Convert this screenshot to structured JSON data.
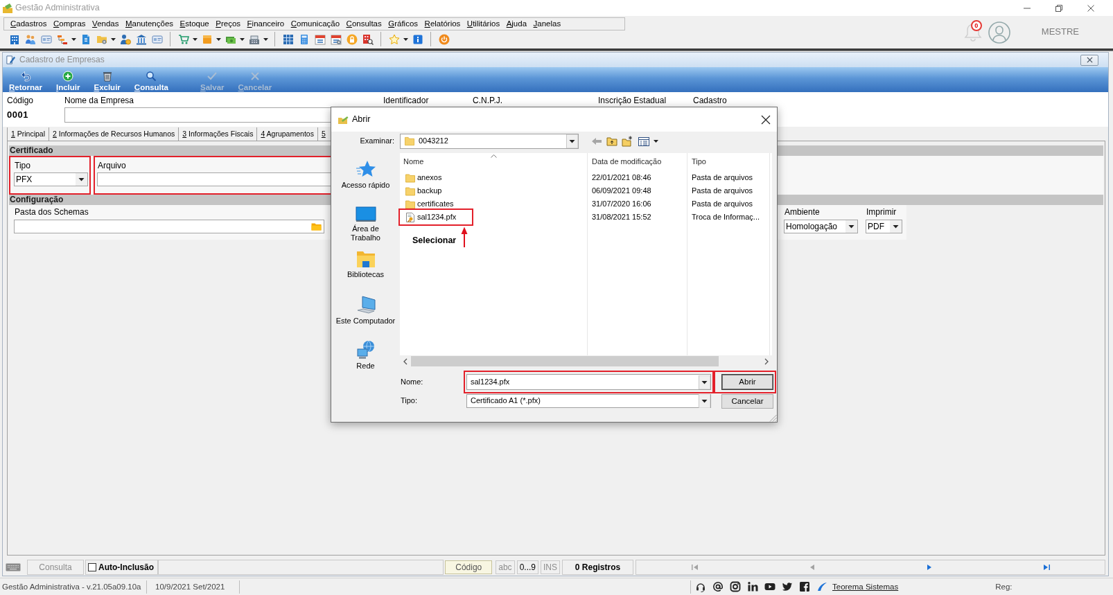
{
  "window": {
    "title": "Gestão Administrativa"
  },
  "menu": [
    "Cadastros",
    "Compras",
    "Vendas",
    "Manutenções",
    "Estoque",
    "Preços",
    "Financeiro",
    "Comunicação",
    "Consultas",
    "Gráficos",
    "Relatórios",
    "Utilitários",
    "Ajuda",
    "Janelas"
  ],
  "user": {
    "notifications": "0",
    "name": "MESTRE"
  },
  "form_window": {
    "title": "Cadastro de Empresas",
    "actions": [
      {
        "kind": "back",
        "label": "Retornar",
        "disabled": false
      },
      {
        "kind": "add",
        "label": "Incluir",
        "disabled": false
      },
      {
        "kind": "delete",
        "label": "Excluir",
        "disabled": false
      },
      {
        "kind": "search",
        "label": "Consulta",
        "disabled": false
      },
      {
        "kind": "save",
        "label": "Salvar",
        "disabled": true
      },
      {
        "kind": "cancel",
        "label": "Cancelar",
        "disabled": true
      }
    ],
    "header_fields": [
      {
        "kind": "display",
        "label": "Código",
        "value": "0001"
      },
      {
        "kind": "input",
        "label": "Nome da Empresa"
      },
      {
        "kind": "covered",
        "label": "Identificador"
      },
      {
        "kind": "covered",
        "label": "C.N.P.J."
      },
      {
        "kind": "covered",
        "label": "Inscrição Estadual"
      },
      {
        "kind": "covered",
        "label": "Cadastro"
      }
    ],
    "tabs": [
      {
        "label": "1 Principal"
      },
      {
        "label": "2 Informações de Recursos Humanos"
      },
      {
        "label": "3 Informações Fiscais"
      },
      {
        "label": "4 Agrupamentos"
      },
      {
        "label": "5"
      }
    ],
    "sections": [
      {
        "title": "Certificado",
        "fields": [
          {
            "kind": "select",
            "label": "Tipo",
            "value": "PFX",
            "highlighted": true
          },
          {
            "kind": "file",
            "label": "Arquivo",
            "highlighted": true
          }
        ]
      },
      {
        "title": "Configuração",
        "fields": [
          {
            "kind": "folder",
            "label": "Pasta dos Schemas",
            "highlighted": false
          },
          {
            "kind": "select",
            "label": "Ambiente",
            "value": "Homologação",
            "highlighted": false
          },
          {
            "kind": "select",
            "label": "Imprimir",
            "value": "PDF",
            "highlighted": false
          }
        ]
      }
    ],
    "status_bar": {
      "items": [
        {
          "kind": "label",
          "label": "Consulta",
          "disabled": true
        },
        {
          "kind": "checkbox",
          "label": "Auto-Inclusão",
          "checked": false
        },
        {
          "kind": "button",
          "label": "Código"
        },
        {
          "kind": "indicator",
          "label": "abc",
          "disabled": true
        },
        {
          "kind": "indicator",
          "label": "0...9",
          "disabled": false
        },
        {
          "kind": "indicator",
          "label": "INS",
          "disabled": true
        },
        {
          "kind": "count",
          "label": "0 Registros"
        }
      ],
      "navigation": [
        {
          "kind": "first",
          "disabled": true
        },
        {
          "kind": "previous",
          "disabled": true
        },
        {
          "kind": "next",
          "disabled": false
        },
        {
          "kind": "last",
          "disabled": false
        }
      ]
    }
  },
  "dialog": {
    "title": "Abrir",
    "look_in": {
      "label": "Examinar:",
      "value": "0043212"
    },
    "places": [
      {
        "kind": "quick_access",
        "label": "Acesso rápido"
      },
      {
        "kind": "desktop",
        "label": "Área de Trabalho"
      },
      {
        "kind": "libraries",
        "label": "Bibliotecas"
      },
      {
        "kind": "computer",
        "label": "Este Computador"
      },
      {
        "kind": "network",
        "label": "Rede"
      }
    ],
    "columns": [
      {
        "label": "Nome",
        "sorted": true
      },
      {
        "label": "Data de modificação",
        "sorted": false
      },
      {
        "label": "Tipo",
        "sorted": false
      }
    ],
    "files": [
      {
        "kind": "folder",
        "name": "anexos",
        "modified": "22/01/2021 08:46",
        "type": "Pasta de arquivos",
        "highlighted": false
      },
      {
        "kind": "folder",
        "name": "backup",
        "modified": "06/09/2021 09:48",
        "type": "Pasta de arquivos",
        "highlighted": false
      },
      {
        "kind": "folder",
        "name": "certificates",
        "modified": "31/07/2020 16:06",
        "type": "Pasta de arquivos",
        "highlighted": false
      },
      {
        "kind": "certificate",
        "name": "sal1234.pfx",
        "modified": "31/08/2021 15:52",
        "type": "Troca de Informaç...",
        "highlighted": true
      }
    ],
    "annotation": {
      "text": "Selecionar"
    },
    "file_name": {
      "label": "Nome:",
      "value": "sal1234.pfx",
      "highlighted": true
    },
    "file_type": {
      "label": "Tipo:",
      "value": "Certificado A1 (*.pfx)"
    },
    "buttons": [
      {
        "label": "Abrir",
        "default": true,
        "highlighted": true
      },
      {
        "label": "Cancelar",
        "default": false,
        "highlighted": false
      }
    ]
  },
  "footer": {
    "version": "Gestão Administrativa - v.21.05a09.10a",
    "period": "10/9/2021 Set/2021",
    "link": "Teorema Sistemas",
    "registration_label": "Reg:"
  }
}
